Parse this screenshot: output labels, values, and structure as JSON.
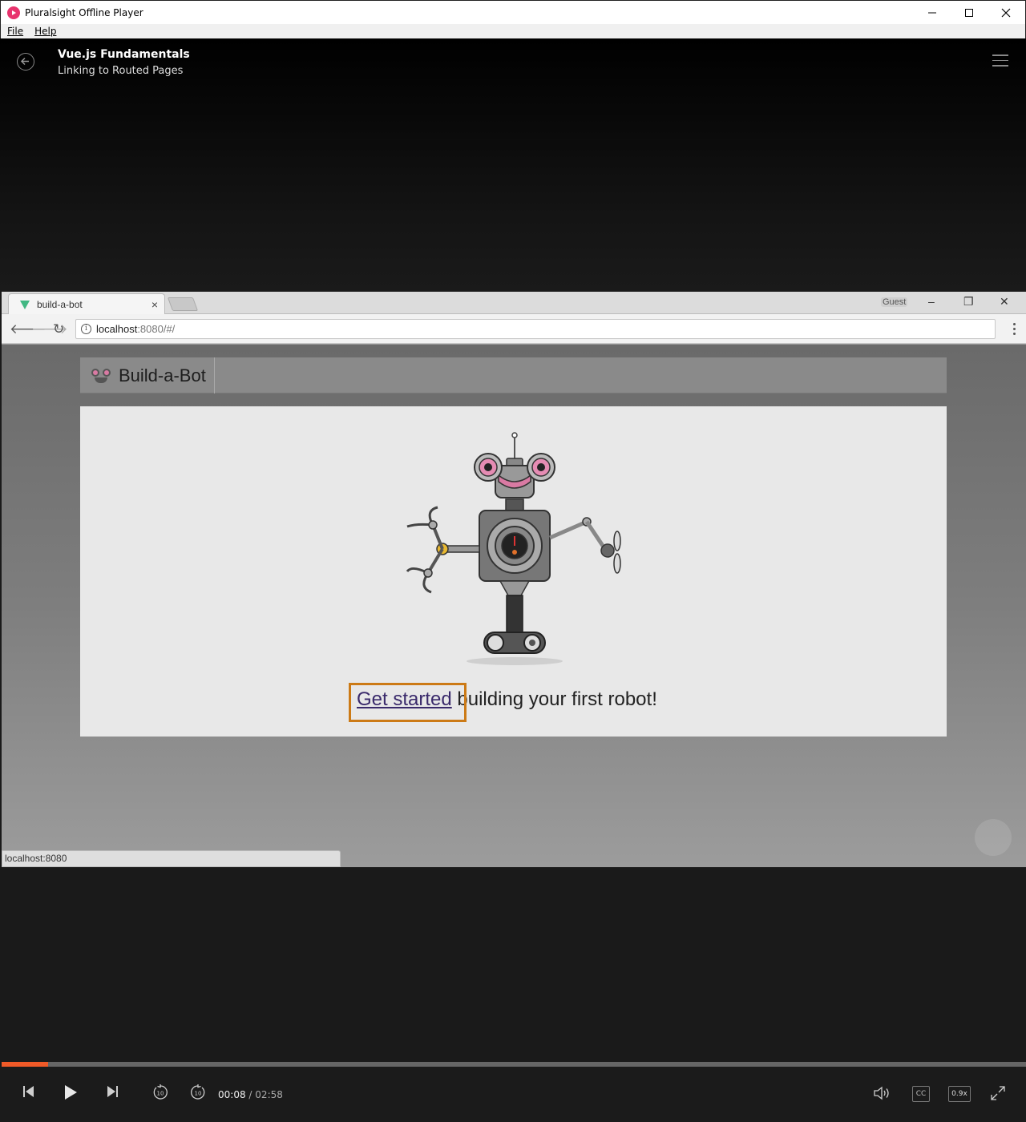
{
  "window": {
    "title": "Pluralsight Offline Player",
    "menu": [
      "File",
      "Help"
    ]
  },
  "header": {
    "course_title": "Vue.js Fundamentals",
    "clip_title": "Linking to Routed Pages"
  },
  "video_content": {
    "browser": {
      "tab_title": "build-a-bot",
      "profile_label": "Guest",
      "url_host": "localhost",
      "url_rest": ":8080/#/",
      "status_bar": "localhost:8080"
    },
    "site": {
      "title": "Build-a-Bot",
      "link_text": "Get started",
      "cta_rest": " building your first robot!"
    }
  },
  "playback": {
    "current_time": "00:08",
    "separator": "/",
    "duration": "02:58",
    "progress_fraction": 0.045,
    "cc_label": "CC",
    "speed_label": "0.9x",
    "skip_seconds": "10"
  },
  "colors": {
    "accent": "#f05a28",
    "brand": "#e8336d",
    "highlight": "#cc7a16"
  }
}
